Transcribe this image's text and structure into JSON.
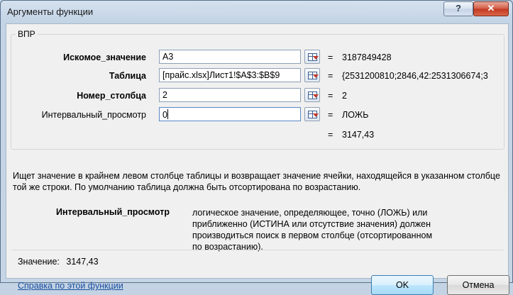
{
  "window": {
    "title": "Аргументы функции",
    "help_glyph": "?",
    "close_glyph": "✕"
  },
  "function_name": "ВПР",
  "args": [
    {
      "label": "Искомое_значение",
      "input": "A3",
      "result": "3187849428",
      "bold": true
    },
    {
      "label": "Таблица",
      "input": "[прайс.xlsx]Лист1!$A$3:$B$9",
      "result": "{2531200810;2846,42:2531306674;3",
      "bold": true
    },
    {
      "label": "Номер_столбца",
      "input": "2",
      "result": "2",
      "bold": true
    },
    {
      "label": "Интервальный_просмотр",
      "input": "0",
      "result": "ЛОЖЬ",
      "bold": false
    }
  ],
  "equals_sign": "=",
  "formula_result": "3147,43",
  "description": "Ищет значение в крайнем левом столбце таблицы и возвращает значение ячейки, находящейся в указанном столбце той же строки. По умолчанию таблица должна быть отсортирована по возрастанию.",
  "arg_help": {
    "name": "Интервальный_просмотр",
    "text": "логическое значение, определяющее, точно (ЛОЖЬ) или приближенно (ИСТИНА или отсутствие значения) должен производиться поиск в первом столбце (отсортированном по возрастанию)."
  },
  "value_label": "Значение:",
  "value": "3147,43",
  "help_link": "Справка по этой функции",
  "buttons": {
    "ok": "OK",
    "cancel": "Отмена"
  },
  "icons": {
    "collapse": "collapse-dialog-icon"
  }
}
